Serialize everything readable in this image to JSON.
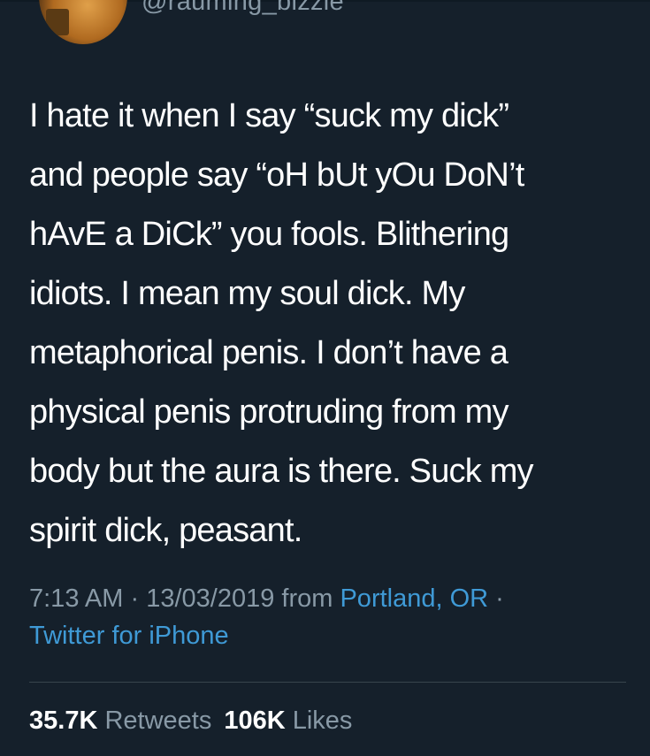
{
  "author": {
    "handle": "@rauming_bizzie"
  },
  "tweet": {
    "lines": [
      "I hate it when I say “suck my dick”",
      "and people say “oH bUt yOu DoN’t",
      "hAvE a DiCk” you fools. Blithering",
      "idiots. I mean my soul dick. My",
      "metaphorical penis. I don’t have a",
      "physical penis protruding from my",
      "body but the aura is there. Suck my",
      "spirit dick, peasant."
    ]
  },
  "meta": {
    "time": "7:13 AM",
    "sep1": " · ",
    "date": "13/03/2019",
    "from": " from ",
    "location": "Portland, OR",
    "sep2": " ·",
    "source": "Twitter for iPhone"
  },
  "stats": {
    "retweets_count": "35.7K",
    "retweets_label": "Retweets",
    "likes_count": "106K",
    "likes_label": "Likes"
  },
  "colors": {
    "background": "#15202b",
    "text": "#ffffff",
    "secondary": "#8899a6",
    "link": "#3f9ad6",
    "divider": "#38444d"
  }
}
